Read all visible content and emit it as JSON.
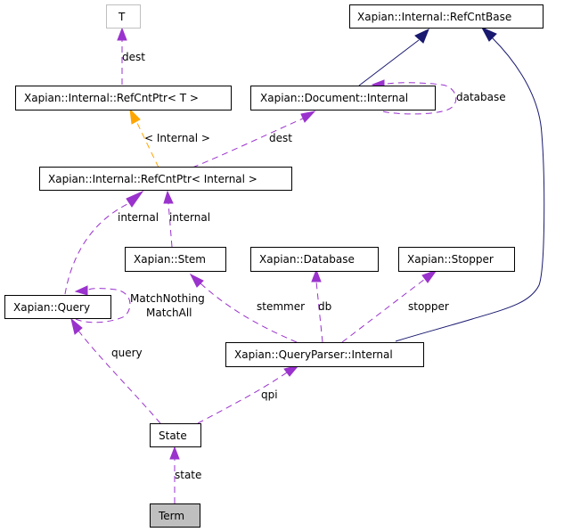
{
  "diagram": {
    "type": "collaboration-graph",
    "colors": {
      "usage_edge": "#9a32cd",
      "template_edge": "#ffa500",
      "inheritance_edge": "#191970",
      "focus_node_fill": "#bfbfbf",
      "ghost_node_border": "#bfbfbf"
    },
    "nodes": {
      "t": "T",
      "refcntbase": "Xapian::Internal::RefCntBase",
      "refcntptr_t": "Xapian::Internal::RefCntPtr< T >",
      "document_internal": "Xapian::Document::Internal",
      "refcntptr_internal": "Xapian::Internal::RefCntPtr< Internal >",
      "stem": "Xapian::Stem",
      "database": "Xapian::Database",
      "stopper": "Xapian::Stopper",
      "query": "Xapian::Query",
      "queryparser_internal": "Xapian::QueryParser::Internal",
      "state": "State",
      "term": "Term"
    },
    "edge_labels": {
      "dest_t": "dest",
      "database_self": "database",
      "template_internal": "< Internal >",
      "dest_document": "dest",
      "internal_query": "internal",
      "internal_stem": "internal",
      "match_nothing": "MatchNothing",
      "match_all": "MatchAll",
      "stemmer": "stemmer",
      "db": "db",
      "stopper": "stopper",
      "query": "query",
      "qpi": "qpi",
      "state": "state"
    }
  }
}
